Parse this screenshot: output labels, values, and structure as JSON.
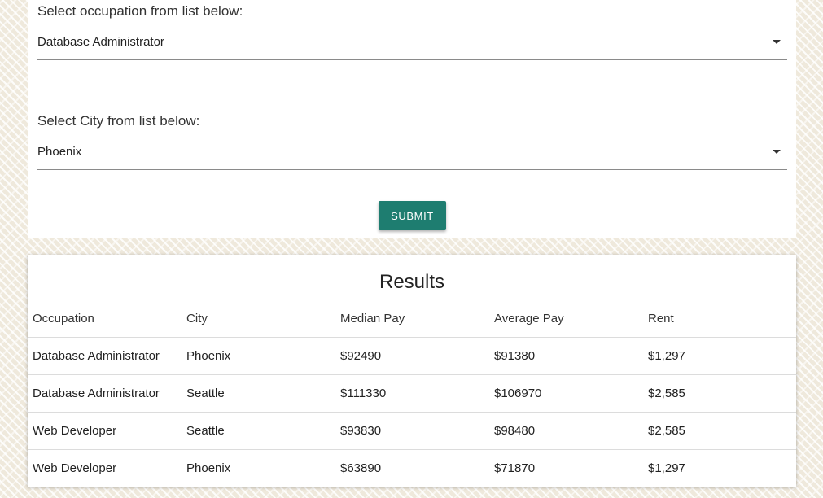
{
  "form": {
    "occupation_label": "Select occupation from list below:",
    "occupation_value": "Database Administrator",
    "city_label": "Select City from list below:",
    "city_value": "Phoenix",
    "submit_label": "SUBMIT"
  },
  "results": {
    "title": "Results",
    "columns": [
      "Occupation",
      "City",
      "Median Pay",
      "Average Pay",
      "Rent"
    ],
    "rows": [
      [
        "Database Administrator",
        "Phoenix",
        "$92490",
        "$91380",
        "$1,297"
      ],
      [
        "Database Administrator",
        "Seattle",
        "$111330",
        "$106970",
        "$2,585"
      ],
      [
        "Web Developer",
        "Seattle",
        "$93830",
        "$98480",
        "$2,585"
      ],
      [
        "Web Developer",
        "Phoenix",
        "$63890",
        "$71870",
        "$1,297"
      ]
    ]
  },
  "colors": {
    "accent": "#1e7d70",
    "background": "#efe9dc"
  },
  "icons": {
    "dropdown": "caret-down-icon"
  }
}
